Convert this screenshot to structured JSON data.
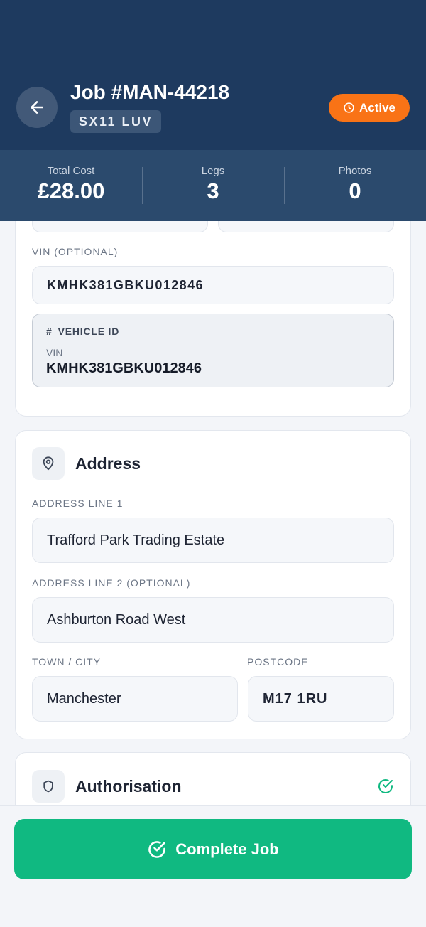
{
  "header": {
    "title": "Job #MAN-44218",
    "plate": "SX11 LUV",
    "status": "Active",
    "back_icon": "arrow-left-icon",
    "status_icon": "clock-icon"
  },
  "stats": [
    {
      "label": "Total Cost",
      "value": "£28.00"
    },
    {
      "label": "Legs",
      "value": "3"
    },
    {
      "label": "Photos",
      "value": "0"
    }
  ],
  "vehicle": {
    "vin_label": "VIN (OPTIONAL)",
    "vin_value": "KMHK381GBKU012846",
    "id_box": {
      "heading": "VEHICLE ID",
      "icon": "hash-icon",
      "sub_label": "VIN",
      "value": "KMHK381GBKU012846"
    }
  },
  "address": {
    "title": "Address",
    "icon": "map-pin-icon",
    "line1_label": "ADDRESS LINE 1",
    "line1_value": "Trafford Park Trading Estate",
    "line2_label": "ADDRESS LINE 2 (OPTIONAL)",
    "line2_value": "Ashburton Road West",
    "town_label": "TOWN / CITY",
    "town_value": "Manchester",
    "postcode_label": "POSTCODE",
    "postcode_value": "M17 1RU"
  },
  "authorisation": {
    "title": "Authorisation",
    "icon": "shield-icon",
    "status_icon": "check-circle-icon"
  },
  "footer": {
    "complete_label": "Complete Job",
    "complete_icon": "check-circle-icon"
  },
  "colors": {
    "header": "#1e3a5f",
    "stats_bar": "#2b4a6d",
    "status_badge": "#f97316",
    "primary_action": "#10b981"
  }
}
